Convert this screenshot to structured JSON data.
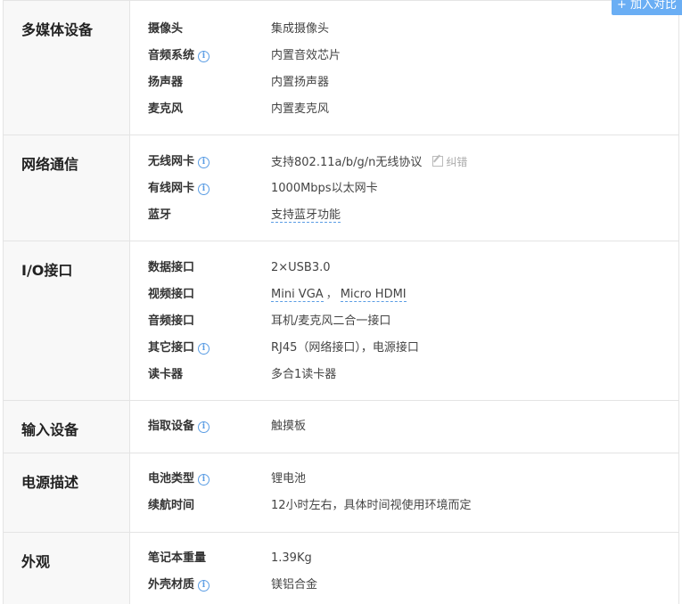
{
  "compare_button": "+ 加入对比",
  "correct_label": "纠错",
  "sections": {
    "multimedia": {
      "title": "多媒体设备",
      "rows": [
        {
          "label": "摄像头",
          "value": "集成摄像头"
        },
        {
          "label": "音频系统",
          "value": "内置音效芯片"
        },
        {
          "label": "扬声器",
          "value": "内置扬声器"
        },
        {
          "label": "麦克风",
          "value": "内置麦克风"
        }
      ]
    },
    "network": {
      "title": "网络通信",
      "rows": [
        {
          "label": "无线网卡",
          "value": "支持802.11a/b/g/n无线协议"
        },
        {
          "label": "有线网卡",
          "value": "1000Mbps以太网卡"
        },
        {
          "label": "蓝牙",
          "value": "支持蓝牙功能"
        }
      ]
    },
    "io": {
      "title": "I/O接口",
      "rows": [
        {
          "label": "数据接口",
          "value": "2×USB3.0"
        },
        {
          "label": "视频接口",
          "value_a": "Mini VGA",
          "sep": "，",
          "value_b": "Micro HDMI"
        },
        {
          "label": "音频接口",
          "value": "耳机/麦克风二合一接口"
        },
        {
          "label": "其它接口",
          "value": "RJ45（网络接口），电源接口"
        },
        {
          "label": "读卡器",
          "value": "多合1读卡器"
        }
      ]
    },
    "input": {
      "title": "输入设备",
      "rows": [
        {
          "label": "指取设备",
          "value": "触摸板"
        }
      ]
    },
    "power": {
      "title": "电源描述",
      "rows": [
        {
          "label": "电池类型",
          "value": "锂电池"
        },
        {
          "label": "续航时间",
          "value": "12小时左右，具体时间视使用环境而定"
        }
      ]
    },
    "appearance": {
      "title": "外观",
      "rows": [
        {
          "label": "笔记本重量",
          "value": "1.39Kg"
        },
        {
          "label": "外壳材质",
          "value": "镁铝合金"
        }
      ]
    }
  }
}
